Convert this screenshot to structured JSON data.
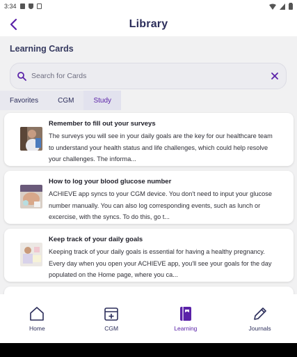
{
  "status_bar": {
    "time": "3:34"
  },
  "header": {
    "title": "Library",
    "back_icon": "chevron-left-icon"
  },
  "main": {
    "section_title": "Learning Cards",
    "search": {
      "placeholder": "Search for Cards",
      "icon": "search-icon",
      "clear_icon": "close-icon"
    },
    "tabs": [
      {
        "label": "Favorites",
        "active": false
      },
      {
        "label": "CGM",
        "active": false
      },
      {
        "label": "Study",
        "active": true
      }
    ],
    "cards": [
      {
        "title": "Remember to fill out your surveys",
        "description": "The surveys you will see in your daily goals are the key for our healthcare team to understand your health status and life challenges, which could help resolve your challenges. The informa..."
      },
      {
        "title": "How to log your blood glucose number",
        "description": "ACHIEVE app syncs to your CGM device. You don't need to input your glucose number manually. You can also log corresponding events, such as lunch or excercise, with the syncs. To do this, go t..."
      },
      {
        "title": "Keep track of your daily goals",
        "description": "Keeping track of your daily goals is essential for having a healthy pregnancy. Every day when you open your ACHIEVE app, you'll see your goals for the day populated on the Home page, where you ca..."
      }
    ]
  },
  "bottom_nav": [
    {
      "label": "Home",
      "icon": "home-icon",
      "active": false
    },
    {
      "label": "CGM",
      "icon": "cgm-icon",
      "active": false
    },
    {
      "label": "Learning",
      "icon": "book-icon",
      "active": true
    },
    {
      "label": "Journals",
      "icon": "pencil-icon",
      "active": false
    }
  ],
  "colors": {
    "accent": "#5a22a8",
    "title_text": "#2b2d5a",
    "background": "#f1f1f2"
  }
}
